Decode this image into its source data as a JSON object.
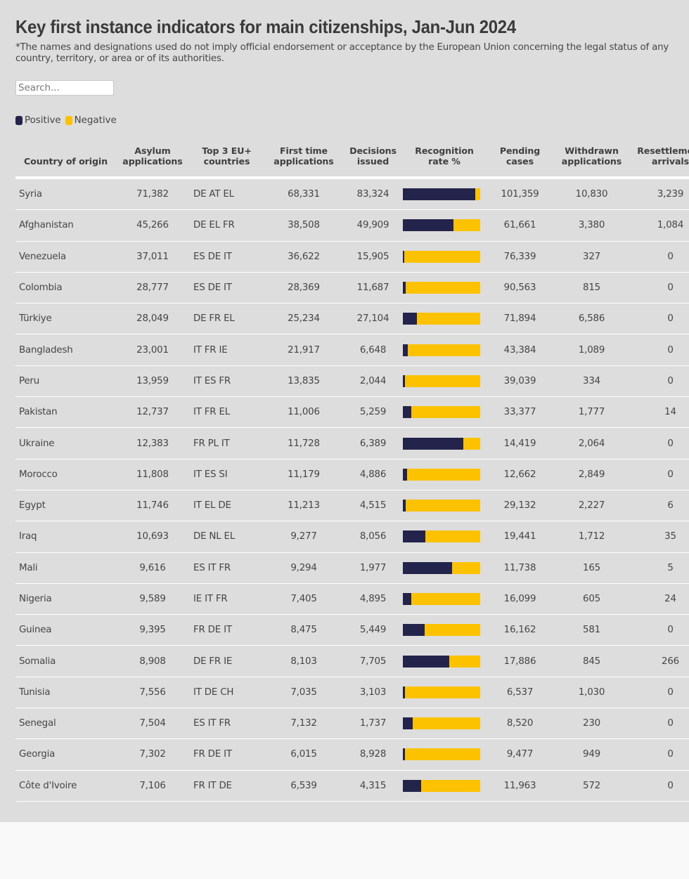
{
  "title": "Key first instance indicators for main citizenships, Jan-Jun 2024",
  "note": "*The names and designations used do not imply official endorsement or acceptance by the European Union concerning the legal status of any country, territory, or area or of its authorities.",
  "search": {
    "placeholder": "Search...",
    "value": ""
  },
  "legend": [
    {
      "label": "Positive",
      "color": "#23234b"
    },
    {
      "label": "Negative",
      "color": "#fcc200"
    }
  ],
  "colors": {
    "positive": "#23234b",
    "negative": "#fcc200",
    "panel_bg": "#dddddd"
  },
  "columns": [
    [
      "Country of origin"
    ],
    [
      "Asylum",
      "applications"
    ],
    [
      "Top 3 EU+",
      "countries"
    ],
    [
      "First time",
      "applications"
    ],
    [
      "Decisions",
      "issued"
    ],
    [
      "Recognition",
      "rate %"
    ],
    [
      "Pending",
      "cases"
    ],
    [
      "Withdrawn",
      "applications"
    ],
    [
      "Resettlement",
      "arrivals"
    ]
  ],
  "rows": [
    {
      "country": "Syria",
      "asylum": "71,382",
      "top3": "DE AT EL",
      "first_time": "68,331",
      "decisions": "83,324",
      "recognition_rate": 94,
      "pending": "101,359",
      "withdrawn": "10,830",
      "resettlement": "3,239"
    },
    {
      "country": "Afghanistan",
      "asylum": "45,266",
      "top3": "DE EL FR",
      "first_time": "38,508",
      "decisions": "49,909",
      "recognition_rate": 65,
      "pending": "61,661",
      "withdrawn": "3,380",
      "resettlement": "1,084"
    },
    {
      "country": "Venezuela",
      "asylum": "37,011",
      "top3": "ES DE IT",
      "first_time": "36,622",
      "decisions": "15,905",
      "recognition_rate": 2,
      "pending": "76,339",
      "withdrawn": "327",
      "resettlement": "0"
    },
    {
      "country": "Colombia",
      "asylum": "28,777",
      "top3": "ES DE IT",
      "first_time": "28,369",
      "decisions": "11,687",
      "recognition_rate": 4,
      "pending": "90,563",
      "withdrawn": "815",
      "resettlement": "0"
    },
    {
      "country": "Türkiye",
      "asylum": "28,049",
      "top3": "DE FR EL",
      "first_time": "25,234",
      "decisions": "27,104",
      "recognition_rate": 18,
      "pending": "71,894",
      "withdrawn": "6,586",
      "resettlement": "0"
    },
    {
      "country": "Bangladesh",
      "asylum": "23,001",
      "top3": "IT FR IE",
      "first_time": "21,917",
      "decisions": "6,648",
      "recognition_rate": 6,
      "pending": "43,384",
      "withdrawn": "1,089",
      "resettlement": "0"
    },
    {
      "country": "Peru",
      "asylum": "13,959",
      "top3": "IT ES FR",
      "first_time": "13,835",
      "decisions": "2,044",
      "recognition_rate": 3,
      "pending": "39,039",
      "withdrawn": "334",
      "resettlement": "0"
    },
    {
      "country": "Pakistan",
      "asylum": "12,737",
      "top3": "IT FR EL",
      "first_time": "11,006",
      "decisions": "5,259",
      "recognition_rate": 11,
      "pending": "33,377",
      "withdrawn": "1,777",
      "resettlement": "14"
    },
    {
      "country": "Ukraine",
      "asylum": "12,383",
      "top3": "FR PL IT",
      "first_time": "11,728",
      "decisions": "6,389",
      "recognition_rate": 78,
      "pending": "14,419",
      "withdrawn": "2,064",
      "resettlement": "0"
    },
    {
      "country": "Morocco",
      "asylum": "11,808",
      "top3": "IT ES SI",
      "first_time": "11,179",
      "decisions": "4,886",
      "recognition_rate": 5,
      "pending": "12,662",
      "withdrawn": "2,849",
      "resettlement": "0"
    },
    {
      "country": "Egypt",
      "asylum": "11,746",
      "top3": "IT EL DE",
      "first_time": "11,213",
      "decisions": "4,515",
      "recognition_rate": 4,
      "pending": "29,132",
      "withdrawn": "2,227",
      "resettlement": "6"
    },
    {
      "country": "Iraq",
      "asylum": "10,693",
      "top3": "DE NL EL",
      "first_time": "9,277",
      "decisions": "8,056",
      "recognition_rate": 29,
      "pending": "19,441",
      "withdrawn": "1,712",
      "resettlement": "35"
    },
    {
      "country": "Mali",
      "asylum": "9,616",
      "top3": "ES IT FR",
      "first_time": "9,294",
      "decisions": "1,977",
      "recognition_rate": 64,
      "pending": "11,738",
      "withdrawn": "165",
      "resettlement": "5"
    },
    {
      "country": "Nigeria",
      "asylum": "9,589",
      "top3": "IE IT FR",
      "first_time": "7,405",
      "decisions": "4,895",
      "recognition_rate": 11,
      "pending": "16,099",
      "withdrawn": "605",
      "resettlement": "24"
    },
    {
      "country": "Guinea",
      "asylum": "9,395",
      "top3": "FR DE IT",
      "first_time": "8,475",
      "decisions": "5,449",
      "recognition_rate": 28,
      "pending": "16,162",
      "withdrawn": "581",
      "resettlement": "0"
    },
    {
      "country": "Somalia",
      "asylum": "8,908",
      "top3": "DE FR IE",
      "first_time": "8,103",
      "decisions": "7,705",
      "recognition_rate": 60,
      "pending": "17,886",
      "withdrawn": "845",
      "resettlement": "266"
    },
    {
      "country": "Tunisia",
      "asylum": "7,556",
      "top3": "IT DE CH",
      "first_time": "7,035",
      "decisions": "3,103",
      "recognition_rate": 3,
      "pending": "6,537",
      "withdrawn": "1,030",
      "resettlement": "0"
    },
    {
      "country": "Senegal",
      "asylum": "7,504",
      "top3": "ES IT FR",
      "first_time": "7,132",
      "decisions": "1,737",
      "recognition_rate": 13,
      "pending": "8,520",
      "withdrawn": "230",
      "resettlement": "0"
    },
    {
      "country": "Georgia",
      "asylum": "7,302",
      "top3": "FR DE IT",
      "first_time": "6,015",
      "decisions": "8,928",
      "recognition_rate": 3,
      "pending": "9,477",
      "withdrawn": "949",
      "resettlement": "0"
    },
    {
      "country": "Côte d'Ivoire",
      "asylum": "7,106",
      "top3": "FR IT DE",
      "first_time": "6,539",
      "decisions": "4,315",
      "recognition_rate": 24,
      "pending": "11,963",
      "withdrawn": "572",
      "resettlement": "0"
    }
  ]
}
